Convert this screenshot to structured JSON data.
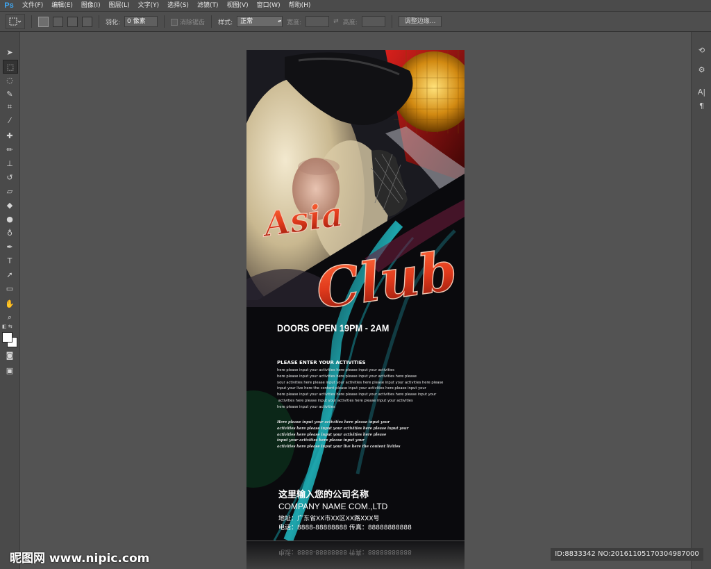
{
  "app": {
    "logo": "Ps"
  },
  "menu": [
    "文件(F)",
    "编辑(E)",
    "图像(I)",
    "图层(L)",
    "文字(Y)",
    "选择(S)",
    "滤镜(T)",
    "视图(V)",
    "窗口(W)",
    "帮助(H)"
  ],
  "options": {
    "feather_label": "羽化:",
    "feather_value": "0 像素",
    "antialias_label": "消除锯齿",
    "style_label": "样式:",
    "style_value": "正常",
    "width_label": "宽度:",
    "height_label": "高度:",
    "refine_button": "调整边缘..."
  },
  "poster": {
    "title_line1": "Asia",
    "title_line2": "Club",
    "doors": "DOORS OPEN 19PM - 2AM",
    "activities_title": "PLEASE ENTER YOUR ACTIVITIES",
    "body1": "here please input your activities here please input your activities\nhere please input your activities here please input your activities here please\nyour activities here please input your activities here please input your activities here please\ninput your live here the content please input your activities here please input your\nhere please input your activities here please input your activities here please input your\n activities here please input your activities here please input your activities\nhere please input your activities",
    "body2": "Here please input your activities here please input your\nactivities here please input your activities here please input your\nactivities here please input your activities here please\ninput your activities here please input your\nactivities here please input your live here the content livities",
    "company_cn": "这里输入您的公司名称",
    "company_en": "COMPANY NAME COM.,LTD",
    "address": "地址：广东省XX市XX区XX路XXX号",
    "phone": "电话：8888-88888888  传真：88888888888"
  },
  "watermark": {
    "left": "昵图网 www.nipic.com",
    "right": "ID:8833342 NO:20161105170304987000"
  },
  "colors": {
    "accent": "#3fa9f5",
    "title_red": "#e03a1c"
  }
}
